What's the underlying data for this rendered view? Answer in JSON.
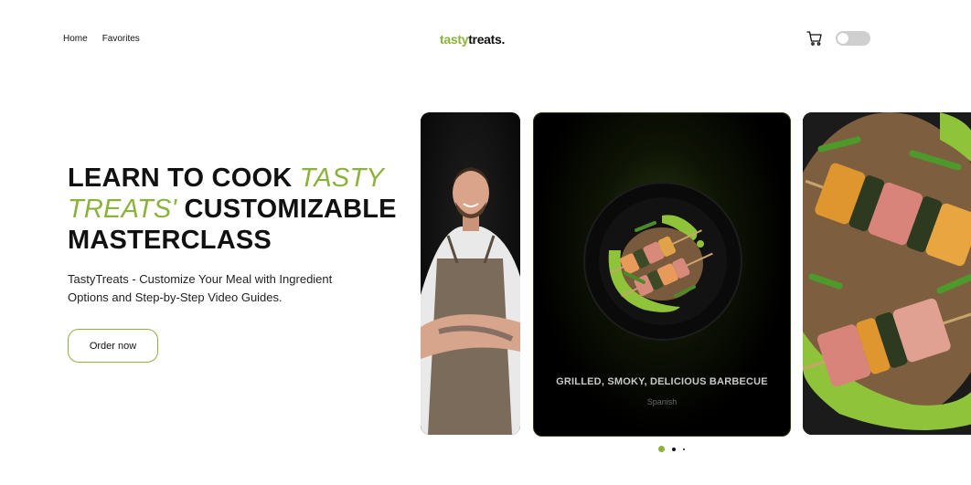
{
  "header": {
    "nav": [
      {
        "label": "Home"
      },
      {
        "label": "Favorites"
      }
    ],
    "logo": {
      "part1": "tasty",
      "part2": "treats."
    },
    "cart_icon": "cart-icon",
    "theme_toggle": {
      "state": "off"
    }
  },
  "hero": {
    "title_line1": "LEARN TO COOK ",
    "title_accent": "TASTY TREATS'",
    "title_rest": " CUSTOMIZABLE MASTERCLASS",
    "subtitle": "TastyTreats - Customize Your Meal with Ingredient Options and Step-by-Step Video Guides.",
    "cta": "Order now"
  },
  "carousel": {
    "main_card": {
      "title": "GRILLED, SMOKY, DELICIOUS BARBECUE",
      "tag": "Spanish"
    },
    "active_index": 0,
    "dot_count": 3
  },
  "colors": {
    "accent": "#8bb33a",
    "text": "#111111"
  }
}
